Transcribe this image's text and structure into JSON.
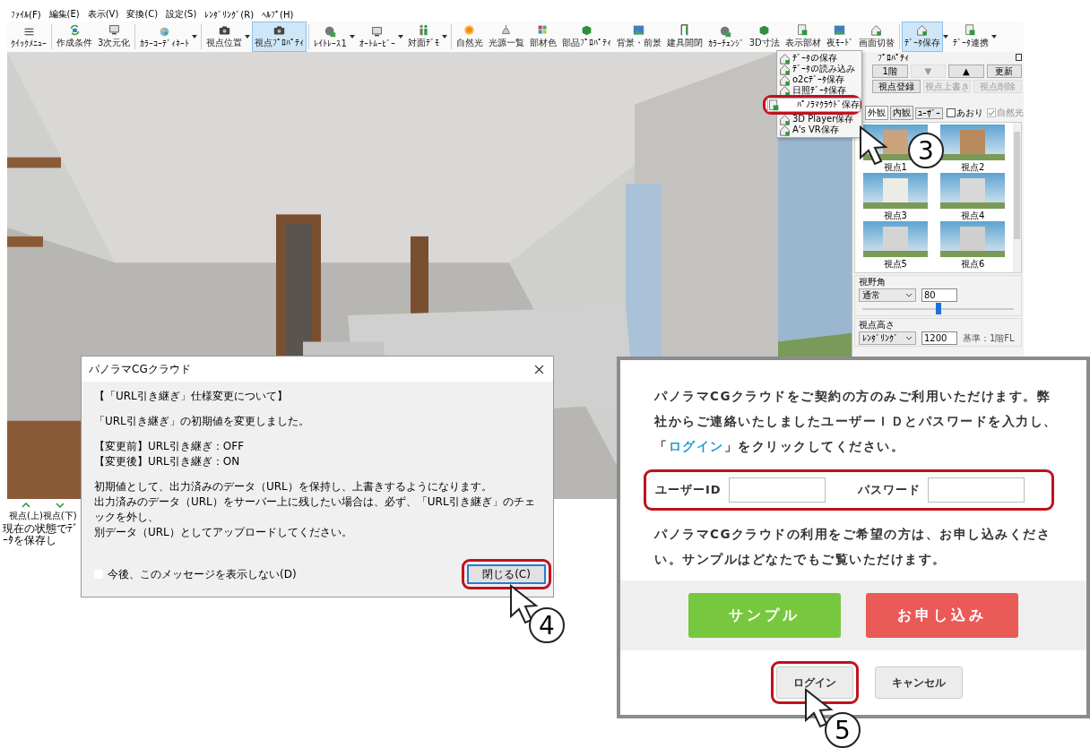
{
  "menu_bar": [
    "ﾌｧｲﾙ(F)",
    "編集(E)",
    "表示(V)",
    "変換(C)",
    "設定(S)",
    "ﾚﾝﾀﾞﾘﾝｸﾞ(R)",
    "ﾍﾙﾌﾟ(H)"
  ],
  "toolbar": [
    {
      "label": "ｸｲｯｸﾒﾆｭｰ",
      "kind": "menu",
      "dropdown": false,
      "selected": false
    },
    {
      "label": "作成条件",
      "kind": "arrows",
      "dropdown": false,
      "selected": false
    },
    {
      "label": "3次元化",
      "kind": "screen",
      "dropdown": false,
      "selected": false
    },
    {
      "label": "ｶﾗｰｺｰﾃﾞｨﾈｰﾄ",
      "kind": "palette",
      "dropdown": true,
      "selected": false
    },
    {
      "label": "視点位置",
      "kind": "camera",
      "dropdown": true,
      "selected": false
    },
    {
      "label": "視点ﾌﾟﾛﾊﾟﾃｨ",
      "kind": "camera",
      "dropdown": false,
      "selected": true
    },
    {
      "label": "ﾚｲﾄﾚｰｽ1",
      "kind": "globe",
      "dropdown": true,
      "selected": false
    },
    {
      "label": "ｵｰﾄﾑｰﾋﾞｰ",
      "kind": "screen",
      "dropdown": true,
      "selected": false
    },
    {
      "label": "対面ﾃﾞﾓ",
      "kind": "person",
      "dropdown": true,
      "selected": false
    },
    {
      "label": "自然光",
      "kind": "sun",
      "dropdown": false,
      "selected": false
    },
    {
      "label": "光源一覧",
      "kind": "lamp",
      "dropdown": false,
      "selected": false
    },
    {
      "label": "部材色",
      "kind": "swatch",
      "dropdown": false,
      "selected": false
    },
    {
      "label": "部品ﾌﾟﾛﾊﾟﾃｨ",
      "kind": "cube",
      "dropdown": false,
      "selected": false
    },
    {
      "label": "背景・前景",
      "kind": "picture",
      "dropdown": false,
      "selected": false
    },
    {
      "label": "建具開閉",
      "kind": "door",
      "dropdown": false,
      "selected": false
    },
    {
      "label": "ｶﾗｰﾁｪﾝｼﾞ",
      "kind": "globe",
      "dropdown": false,
      "selected": false
    },
    {
      "label": "3D寸法",
      "kind": "cube",
      "dropdown": false,
      "selected": false
    },
    {
      "label": "表示部材",
      "kind": "doc",
      "dropdown": false,
      "selected": false
    },
    {
      "label": "夜ﾓｰﾄﾞ",
      "kind": "picture",
      "dropdown": false,
      "selected": false
    },
    {
      "label": "画面切替",
      "kind": "house",
      "dropdown": false,
      "selected": false
    },
    {
      "label": "ﾃﾞｰﾀ保存",
      "kind": "house",
      "dropdown": true,
      "selected": true
    },
    {
      "label": "ﾃﾞｰﾀ連携",
      "kind": "doc",
      "dropdown": true,
      "selected": false
    }
  ],
  "data_save_menu": [
    {
      "label": "ﾃﾞｰﾀの保存",
      "selected": false
    },
    {
      "label": "ﾃﾞｰﾀの読み込み",
      "selected": false
    },
    {
      "label": "o2cﾃﾞｰﾀ保存",
      "selected": false
    },
    {
      "label": "日照ﾃﾞｰﾀ保存",
      "selected": false
    },
    {
      "label": "ﾊﾟﾉﾗﾏｸﾗｳﾄﾞ保存",
      "selected": true
    },
    {
      "label": "3D Player保存",
      "selected": false
    },
    {
      "label": "A's VR保存",
      "selected": false
    }
  ],
  "viewpoint_panel": {
    "title": "ﾌﾟﾛﾊﾟﾃｨ",
    "floor_buttons": [
      {
        "label": "1階",
        "disabled": false
      },
      {
        "label": "▼",
        "disabled": true
      },
      {
        "label": "▲",
        "disabled": false
      },
      {
        "label": "更新",
        "disabled": false
      }
    ],
    "action_buttons": [
      {
        "label": "視点登録",
        "disabled": false
      },
      {
        "label": "視点上書き",
        "disabled": true
      },
      {
        "label": "視点削除",
        "disabled": true
      }
    ],
    "tabs": [
      {
        "label": "外観",
        "selected": true
      },
      {
        "label": "内観",
        "selected": false
      },
      {
        "label": "ﾕｰｻﾞｰ",
        "selected": false
      }
    ],
    "checkboxes": [
      {
        "label": "あおり",
        "checked": false,
        "disabled": false
      },
      {
        "label": "自然光",
        "checked": true,
        "disabled": true
      }
    ],
    "thumbnails": [
      {
        "label": "視点1"
      },
      {
        "label": "視点2"
      },
      {
        "label": "視点3"
      },
      {
        "label": "視点4"
      },
      {
        "label": "視点5"
      },
      {
        "label": "視点6"
      }
    ],
    "field_of_view": {
      "title": "視野角",
      "mode": "通常",
      "value": "80",
      "level": 0.5
    },
    "eye_height": {
      "title": "視点高さ",
      "mode": "ﾚﾝﾀﾞﾘﾝｸﾞ",
      "value": "1200",
      "note": "基準：1階FL"
    }
  },
  "nav_buttons": [
    {
      "label": "視点(上)",
      "kind": "up"
    },
    {
      "label": "視点(下)",
      "kind": "down"
    }
  ],
  "status_bar": "現在の状態でﾃﾞｰﾀを保存し",
  "notice_dialog": {
    "title": "パノラマCGクラウド",
    "paragraphs": [
      [
        "【「URL引き継ぎ」仕様変更について】"
      ],
      [
        "「URL引き継ぎ」の初期値を変更しました。"
      ],
      [
        "【変更前】URL引き継ぎ：OFF",
        "【変更後】URL引き継ぎ：ON"
      ],
      [
        "初期値として、出力済みのデータ（URL）を保持し、上書きするようになります。",
        "出力済みのデータ（URL）をサーバー上に残したい場合は、必ず、「URL引き継ぎ」のチェックを外し、",
        "別データ（URL）としてアップロードしてください。"
      ]
    ],
    "dont_show": {
      "label": "今後、このメッセージを表示しない(D)",
      "checked": false
    },
    "close_button": "閉じる(C)"
  },
  "login_panel": {
    "intro_before": "パノラマCGクラウドをご契約の方のみご利用いただけます。弊社からご連絡いたしましたユーザーＩＤとパスワードを入力し、「",
    "intro_link": "ログイン",
    "intro_after": "」をクリックしてください。",
    "user_label": "ユーザーID",
    "password_label": "パスワード",
    "apply_text": "パノラマCGクラウドの利用をご希望の方は、お申し込みください。サンプルはどなたでもご覧いただけます。",
    "sample_button": "サンプル",
    "apply_button": "お申し込み",
    "login_button": "ログイン",
    "cancel_button": "キャンセル"
  },
  "callouts": [
    "3",
    "4",
    "5"
  ]
}
